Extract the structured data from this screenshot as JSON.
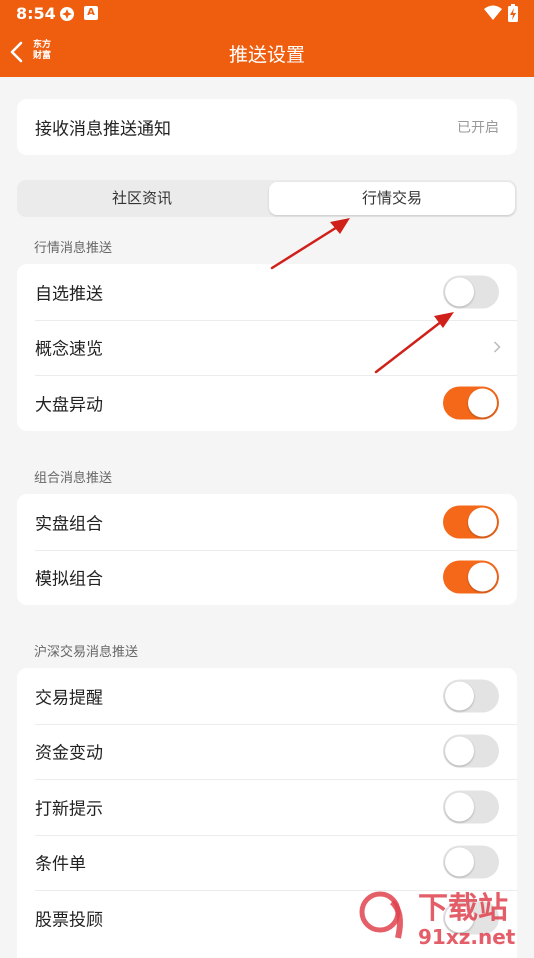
{
  "status_bar": {
    "time": "8:54"
  },
  "nav": {
    "logo_line1": "东方",
    "logo_line2": "财富",
    "title": "推送设置"
  },
  "receive": {
    "label": "接收消息推送通知",
    "value": "已开启"
  },
  "tabs": [
    {
      "label": "社区资讯",
      "selected": false
    },
    {
      "label": "行情交易",
      "selected": true
    }
  ],
  "sections": [
    {
      "title": "行情消息推送",
      "items": [
        {
          "label": "自选推送",
          "control": "toggle",
          "on": false
        },
        {
          "label": "概念速览",
          "control": "chevron"
        },
        {
          "label": "大盘异动",
          "control": "toggle",
          "on": true
        }
      ]
    },
    {
      "title": "组合消息推送",
      "items": [
        {
          "label": "实盘组合",
          "control": "toggle",
          "on": true
        },
        {
          "label": "模拟组合",
          "control": "toggle",
          "on": true
        }
      ]
    },
    {
      "title": "沪深交易消息推送",
      "items": [
        {
          "label": "交易提醒",
          "control": "toggle",
          "on": false
        },
        {
          "label": "资金变动",
          "control": "toggle",
          "on": false
        },
        {
          "label": "打新提示",
          "control": "toggle",
          "on": false
        },
        {
          "label": "条件单",
          "control": "toggle",
          "on": false
        },
        {
          "label": "股票投顾",
          "control": "toggle",
          "on": false
        }
      ]
    }
  ],
  "watermark": {
    "text1": "下载站",
    "text2": "91xz.net"
  },
  "colors": {
    "accent": "#ef5d0e",
    "toggle_on": "#f5681a",
    "toggle_off": "#e3e3e3",
    "annotation_arrow": "#d0201a"
  }
}
